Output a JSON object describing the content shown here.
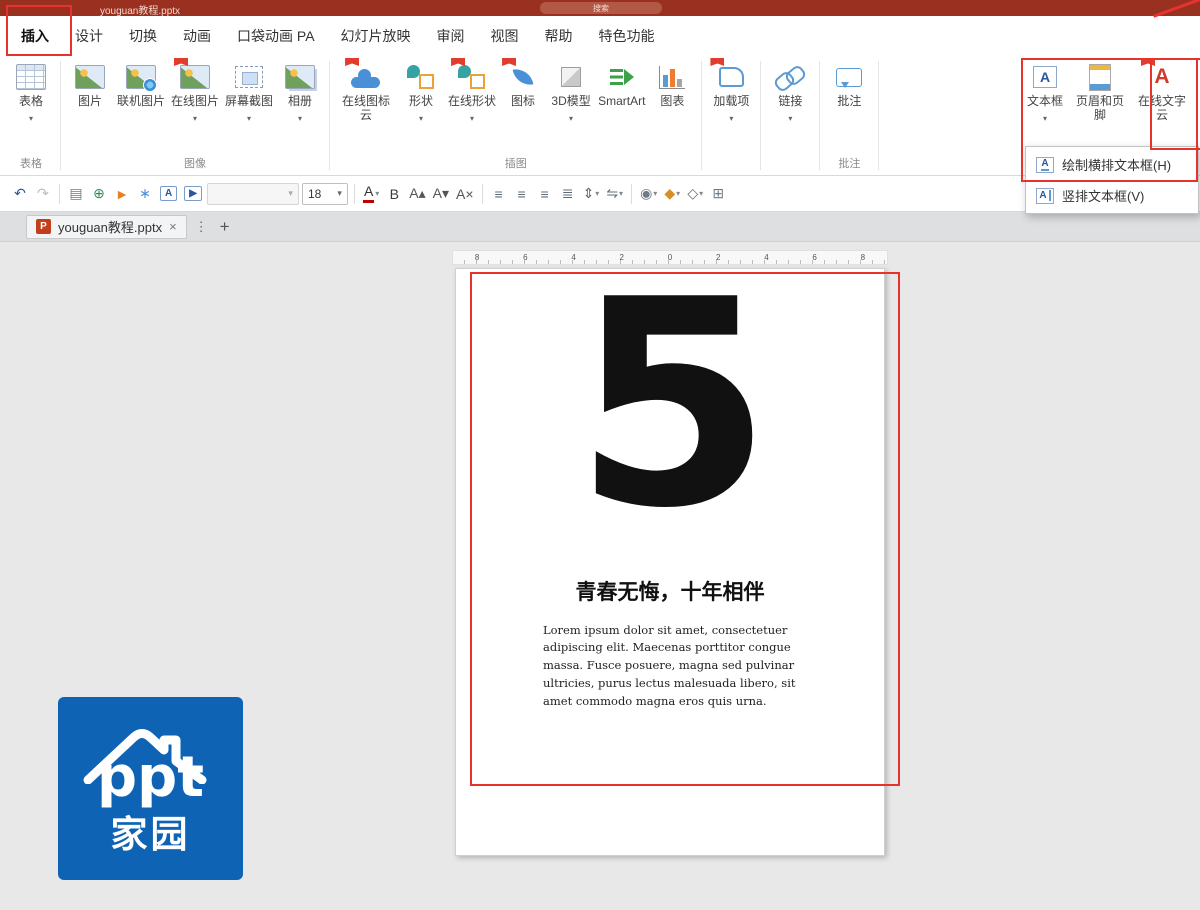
{
  "colors": {
    "titlebar_red": "#9a3120",
    "annotation_red": "#e8322e",
    "accent_blue": "#2b579a",
    "logo_blue": "#0e63b5",
    "ppt_red": "#c43e1c"
  },
  "titlebar": {
    "title": "youguan教程.pptx",
    "search_label": "搜索"
  },
  "menu_tabs": [
    {
      "label": "插入",
      "active": true
    },
    {
      "label": "设计"
    },
    {
      "label": "切换"
    },
    {
      "label": "动画"
    },
    {
      "label": "口袋动画 PA"
    },
    {
      "label": "幻灯片放映"
    },
    {
      "label": "审阅"
    },
    {
      "label": "视图"
    },
    {
      "label": "帮助"
    },
    {
      "label": "特色功能"
    }
  ],
  "ribbon": {
    "groups": [
      {
        "label": "表格",
        "buttons": [
          {
            "label": "表格",
            "icon": "table",
            "arrow": true
          }
        ]
      },
      {
        "label": "图像",
        "buttons": [
          {
            "label": "图片",
            "icon": "picture"
          },
          {
            "label": "联机图片",
            "icon": "picture-globe"
          },
          {
            "label": "在线图片",
            "icon": "picture",
            "banner": true,
            "arrow": true
          },
          {
            "label": "屏幕截图",
            "icon": "screenshot",
            "arrow": true
          },
          {
            "label": "相册",
            "icon": "album",
            "arrow": true
          }
        ]
      },
      {
        "label": "插图",
        "buttons": [
          {
            "label": "在线图标云",
            "icon": "cloud",
            "banner": true
          },
          {
            "label": "形状",
            "icon": "shapes",
            "arrow": true
          },
          {
            "label": "在线形状",
            "icon": "shapes",
            "banner": true,
            "arrow": true
          },
          {
            "label": "图标",
            "icon": "leaf",
            "banner": true
          },
          {
            "label": "3D模型",
            "icon": "cube",
            "arrow": true
          },
          {
            "label": "SmartArt",
            "icon": "smartart"
          },
          {
            "label": "图表",
            "icon": "chart"
          }
        ]
      },
      {
        "label": "",
        "buttons": [
          {
            "label": "加载项",
            "icon": "addin",
            "banner": true,
            "arrow": true
          }
        ]
      },
      {
        "label": "",
        "buttons": [
          {
            "label": "链接",
            "icon": "link",
            "arrow": true
          }
        ]
      },
      {
        "label": "批注",
        "buttons": [
          {
            "label": "批注",
            "icon": "comment"
          }
        ]
      },
      {
        "label": "",
        "buttons": [
          {
            "label": "文本框",
            "icon": "textbox",
            "arrow": true
          },
          {
            "label": "页眉和页脚",
            "icon": "headerfooter"
          },
          {
            "label": "在线文字云",
            "icon": "wordcloud",
            "banner": true
          }
        ]
      }
    ]
  },
  "textbox_menu": {
    "items": [
      {
        "label": "绘制横排文本框(H)",
        "icon": "textbox-h"
      },
      {
        "label": "竖排文本框(V)",
        "icon": "textbox-v"
      }
    ]
  },
  "toolbar": {
    "items": [
      {
        "t": "icon",
        "name": "undo-button",
        "g": "↶",
        "c": "#2b579a"
      },
      {
        "t": "icon",
        "name": "redo-button",
        "g": "↷",
        "c": "#bcbcbc"
      },
      {
        "t": "sep",
        "name": "divider"
      },
      {
        "t": "icon",
        "name": "slide-layout-button",
        "g": "▤",
        "c": "#6f7b87"
      },
      {
        "t": "icon",
        "name": "plugin-green-button",
        "g": "⊕",
        "c": "#2e8b57"
      },
      {
        "t": "icon",
        "name": "plugin-flag-button",
        "g": "►",
        "c": "#e67e22"
      },
      {
        "t": "icon",
        "name": "plugin-star-button",
        "g": "∗",
        "c": "#4a90d9"
      },
      {
        "t": "box",
        "name": "quick-textbox-button",
        "g": "A",
        "c": "#2b579a"
      },
      {
        "t": "box",
        "name": "quick-media-button",
        "g": "▶",
        "c": "#2b579a"
      },
      {
        "t": "font",
        "name": "font-family-select",
        "g": ""
      },
      {
        "t": "size",
        "name": "font-size-select",
        "g": "18"
      },
      {
        "t": "sep",
        "name": "divider"
      },
      {
        "t": "icon",
        "name": "font-color-button",
        "g": "A",
        "c": "#333333",
        "bar": true,
        "arrow": true
      },
      {
        "t": "icon",
        "name": "bold-button",
        "g": "B",
        "c": "#3a3a3a"
      },
      {
        "t": "icon",
        "name": "increase-font-button",
        "g": "A▴",
        "c": "#555555"
      },
      {
        "t": "icon",
        "name": "decrease-font-button",
        "g": "A▾",
        "c": "#555555"
      },
      {
        "t": "icon",
        "name": "clear-format-button",
        "g": "A×",
        "c": "#555555"
      },
      {
        "t": "sep",
        "name": "divider"
      },
      {
        "t": "icon",
        "name": "align-left-button",
        "g": "≡",
        "c": "#5f6b76"
      },
      {
        "t": "icon",
        "name": "align-center-button",
        "g": "≡",
        "c": "#5f6b76"
      },
      {
        "t": "icon",
        "name": "align-right-button",
        "g": "≡",
        "c": "#5f6b76"
      },
      {
        "t": "icon",
        "name": "justify-button",
        "g": "≣",
        "c": "#5f6b76"
      },
      {
        "t": "icon",
        "name": "line-spacing-button",
        "g": "⇕",
        "c": "#5f6b76",
        "arrow": true
      },
      {
        "t": "icon",
        "name": "text-direction-button",
        "g": "⇋",
        "c": "#5f6b76",
        "arrow": true
      },
      {
        "t": "sep",
        "name": "divider"
      },
      {
        "t": "icon",
        "name": "shapes-gallery-button",
        "g": "◉",
        "c": "#6f7b87",
        "arrow": true
      },
      {
        "t": "icon",
        "name": "shape-fill-button",
        "g": "◆",
        "c": "#d98c2b",
        "arrow": true
      },
      {
        "t": "icon",
        "name": "shape-outline-button",
        "g": "◇",
        "c": "#5f6b76",
        "arrow": true
      },
      {
        "t": "icon",
        "name": "quick-table-button",
        "g": "⊞",
        "c": "#6f7b87"
      }
    ]
  },
  "doc_tab": {
    "app_letter": "P",
    "label": "youguan教程.pptx",
    "close_icon": "×",
    "more_icon": "⋮",
    "add_icon": "+"
  },
  "ruler": {
    "numbers": [
      "8",
      "6",
      "4",
      "2",
      "0",
      "2",
      "4",
      "6",
      "8"
    ]
  },
  "slide": {
    "big_number": "5",
    "title": "青春无悔，十年相伴",
    "body": "Lorem ipsum dolor sit amet, consectetuer adipiscing elit. Maecenas porttitor congue massa. Fusce posuere, magna sed pulvinar ultricies, purus lectus malesuada libero, sit amet commodo magna eros quis urna."
  },
  "logo": {
    "line1": "ppt",
    "line2": "家园"
  }
}
